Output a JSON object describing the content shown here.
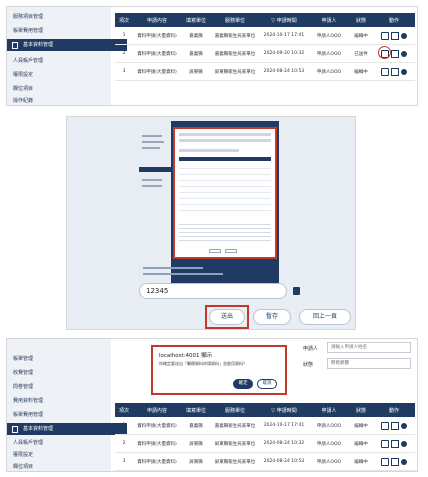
{
  "top": {
    "sidebar": [
      "服務項目管理",
      "帳單費用管理",
      "基本資料管理",
      "人員帳戶管理",
      "權限設定",
      "欄位項目",
      "操作紀錄"
    ],
    "active_index": 2,
    "headers": [
      "項次",
      "申請內容",
      "填寫單位",
      "服務單位",
      "▽ 申請時間",
      "申請人",
      "狀態",
      "動作"
    ],
    "rows": [
      [
        "1",
        "資料申請(大量資料)",
        "嘉義縣",
        "嘉義縣衛生局某單位",
        "2024-10-17 17:41",
        "申請人OOO",
        "編輯中"
      ],
      [
        "2",
        "資料申請(大量資料)",
        "嘉義縣",
        "嘉義縣衛生局某單位",
        "2024-09-20 10:32",
        "申請人OOO",
        "已送件"
      ],
      [
        "3",
        "資料申請(大量資料)",
        "屏東縣",
        "屏東縣衛生局某單位",
        "2024-08-24 10:53",
        "申請人OOO",
        "編輯中"
      ]
    ]
  },
  "middle": {
    "input_value": "12345",
    "buttons": [
      "送出",
      "暫存",
      "回上一頁"
    ]
  },
  "bottom": {
    "sidebar": [
      "帳單管理",
      "收費管理",
      "問卷管理",
      "費用資料管理",
      "帳單費用管理",
      "基本資料管理",
      "人員帳戶管理",
      "權限設定",
      "欄位項目"
    ],
    "active_index": 5,
    "filter_label_1": "申請人",
    "filter_value_1": "請輸入申請人姓名",
    "filter_label_2": "狀態",
    "filter_value_2": "所有狀態",
    "dialog": {
      "title": "localhost:4001 顯示",
      "message": "你確定要送出「醫療資料申請資料」並啟用資料？",
      "ok": "確定",
      "cancel": "取消"
    },
    "headers": [
      "項次",
      "申請內容",
      "填寫單位",
      "服務單位",
      "▽ 申請時間",
      "申請人",
      "狀態",
      "動作"
    ],
    "rows": [
      [
        "1",
        "資料申請(大量資料)",
        "嘉義縣",
        "嘉義縣衛生局某單位",
        "2024-10-17 17:41",
        "申請人OOO",
        "編輯中"
      ],
      [
        "2",
        "資料申請(大量資料)",
        "屏東縣",
        "屏東縣衛生局某單位",
        "2024-08-24 10:32",
        "申請人OOO",
        "編輯中"
      ],
      [
        "3",
        "資料申請(大量資料)",
        "屏東縣",
        "屏東縣衛生局某單位",
        "2024-08-24 10:53",
        "申請人OOO",
        "編輯中"
      ]
    ]
  },
  "colors": {
    "navy": "#1f3b63",
    "highlight": "#c0392b",
    "sidebar_bg": "#eef1f6"
  }
}
